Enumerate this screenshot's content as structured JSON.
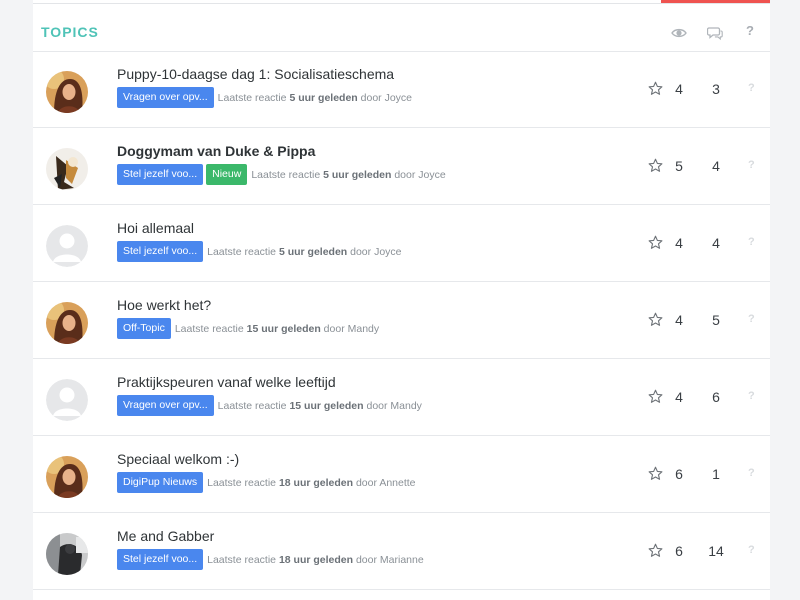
{
  "header": {
    "title": "TOPICS",
    "views_icon": "eye-icon",
    "replies_icon": "comments-icon",
    "third_col": "?"
  },
  "colors": {
    "accent_teal": "#4fc3b7",
    "tag_blue": "#4a87ee",
    "tag_green": "#3bb86a",
    "top_bar_red": "#ef5350"
  },
  "topics": [
    {
      "title": "Puppy-10-daagse dag 1: Socialisatieschema",
      "bold": false,
      "avatar": "photo-woman",
      "tags": [
        "Vragen over opv..."
      ],
      "last_label": "Laatste reactie",
      "last_time": "5 uur geleden",
      "by_label": "door",
      "author": "Joyce",
      "views": "4",
      "replies": "3",
      "extra": "?"
    },
    {
      "title": "Doggymam van Duke & Pippa",
      "bold": true,
      "avatar": "photo-dog",
      "tags": [
        "Stel jezelf voo...",
        "Nieuw"
      ],
      "last_label": "Laatste reactie",
      "last_time": "5 uur geleden",
      "by_label": "door",
      "author": "Joyce",
      "views": "5",
      "replies": "4",
      "extra": "?"
    },
    {
      "title": "Hoi allemaal",
      "bold": false,
      "avatar": "default",
      "tags": [
        "Stel jezelf voo..."
      ],
      "last_label": "Laatste reactie",
      "last_time": "5 uur geleden",
      "by_label": "door",
      "author": "Joyce",
      "views": "4",
      "replies": "4",
      "extra": "?"
    },
    {
      "title": "Hoe werkt het?",
      "bold": false,
      "avatar": "photo-woman",
      "tags": [
        "Off-Topic"
      ],
      "last_label": "Laatste reactie",
      "last_time": "15 uur geleden",
      "by_label": "door",
      "author": "Mandy",
      "views": "4",
      "replies": "5",
      "extra": "?"
    },
    {
      "title": "Praktijkspeuren vanaf welke leeftijd",
      "bold": false,
      "avatar": "default",
      "tags": [
        "Vragen over opv..."
      ],
      "last_label": "Laatste reactie",
      "last_time": "15 uur geleden",
      "by_label": "door",
      "author": "Mandy",
      "views": "4",
      "replies": "6",
      "extra": "?"
    },
    {
      "title": "Speciaal welkom :-)",
      "bold": false,
      "avatar": "photo-woman",
      "tags": [
        "DigiPup Nieuws"
      ],
      "last_label": "Laatste reactie",
      "last_time": "18 uur geleden",
      "by_label": "door",
      "author": "Annette",
      "views": "6",
      "replies": "1",
      "extra": "?"
    },
    {
      "title": "Me and Gabber",
      "bold": false,
      "avatar": "photo-dark",
      "tags": [
        "Stel jezelf voo..."
      ],
      "last_label": "Laatste reactie",
      "last_time": "18 uur geleden",
      "by_label": "door",
      "author": "Marianne",
      "views": "6",
      "replies": "14",
      "extra": "?"
    }
  ]
}
